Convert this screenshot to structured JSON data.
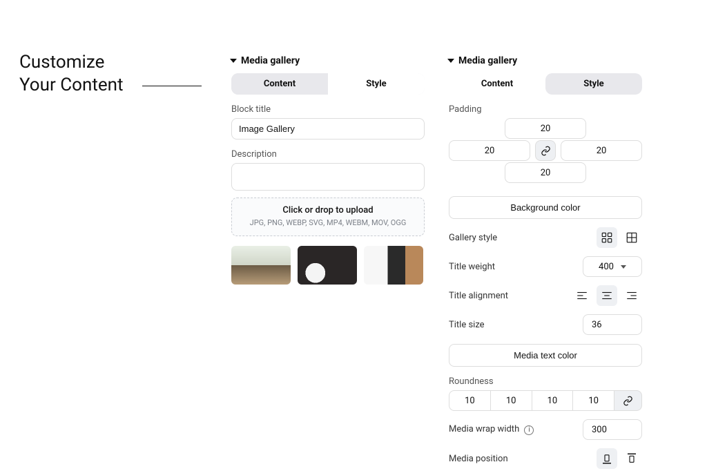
{
  "headline": {
    "line1": "Customize",
    "line2": "Your Content"
  },
  "panel1": {
    "title": "Media gallery",
    "tabs": {
      "content": "Content",
      "style": "Style"
    },
    "fields": {
      "block_title_label": "Block title",
      "block_title_value": "Image Gallery",
      "description_label": "Description",
      "description_value": ""
    },
    "upload": {
      "main": "Click or drop to upload",
      "formats": "JPG, PNG, WEBP, SVG, MP4, WEBM, MOV, OGG"
    }
  },
  "panel2": {
    "title": "Media gallery",
    "tabs": {
      "content": "Content",
      "style": "Style"
    },
    "padding": {
      "label": "Padding",
      "top": "20",
      "right": "20",
      "bottom": "20",
      "left": "20"
    },
    "background_color_btn": "Background color",
    "gallery_style_label": "Gallery style",
    "title_weight": {
      "label": "Title weight",
      "value": "400"
    },
    "title_alignment_label": "Title alignment",
    "title_size": {
      "label": "Title size",
      "value": "36"
    },
    "media_text_color_btn": "Media text color",
    "roundness": {
      "label": "Roundness",
      "tl": "10",
      "tr": "10",
      "br": "10",
      "bl": "10"
    },
    "media_wrap_width": {
      "label": "Media wrap width",
      "value": "300"
    },
    "media_position_label": "Media position"
  }
}
